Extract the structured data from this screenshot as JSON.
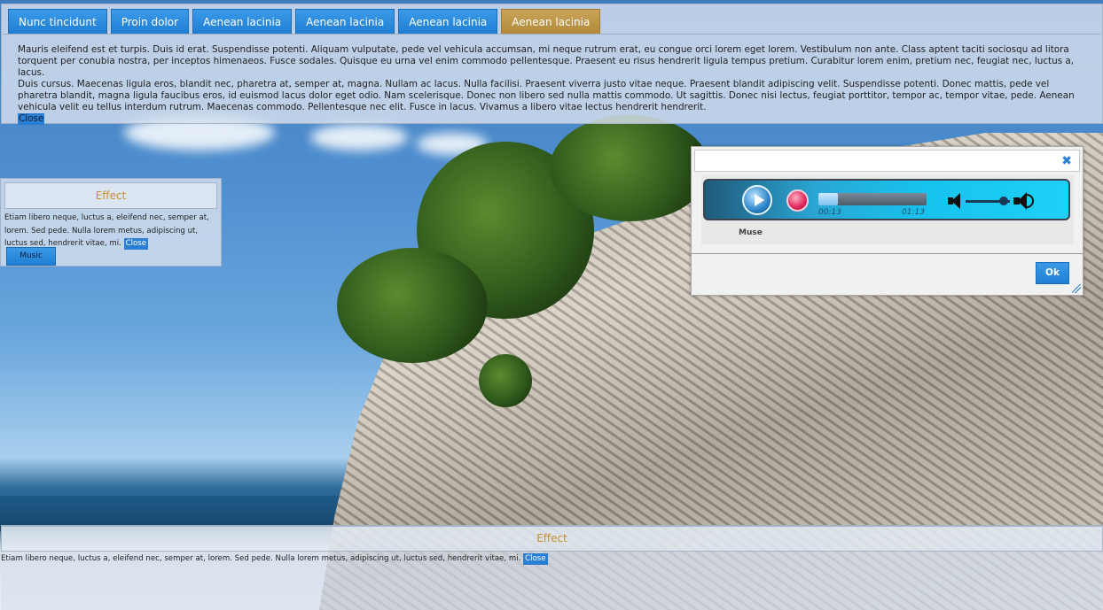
{
  "tabs": [
    {
      "label": "Nunc tincidunt",
      "active": false
    },
    {
      "label": "Proin dolor",
      "active": false
    },
    {
      "label": "Aenean lacinia",
      "active": false
    },
    {
      "label": "Aenean lacinia",
      "active": false
    },
    {
      "label": "Aenean lacinia",
      "active": false
    },
    {
      "label": "Aenean lacinia",
      "active": true
    }
  ],
  "tab_content": {
    "paragraph1": "Mauris eleifend est et turpis. Duis id erat. Suspendisse potenti. Aliquam vulputate, pede vel vehicula accumsan, mi neque rutrum erat, eu congue orci lorem eget lorem. Vestibulum non ante. Class aptent taciti sociosqu ad litora torquent per conubia nostra, per inceptos himenaeos. Fusce sodales. Quisque eu urna vel enim commodo pellentesque. Praesent eu risus hendrerit ligula tempus pretium. Curabitur lorem enim, pretium nec, feugiat nec, luctus a, lacus.",
    "paragraph2": "Duis cursus. Maecenas ligula eros, blandit nec, pharetra at, semper at, magna. Nullam ac lacus. Nulla facilisi. Praesent viverra justo vitae neque. Praesent blandit adipiscing velit. Suspendisse potenti. Donec mattis, pede vel pharetra blandit, magna ligula faucibus eros, id euismod lacus dolor eget odio. Nam scelerisque. Donec non libero sed nulla mattis commodo. Ut sagittis. Donec nisi lectus, feugiat porttitor, tempor ac, tempor vitae, pede. Aenean vehicula velit eu tellus interdum rutrum. Maecenas commodo. Pellentesque nec elit. Fusce in lacus. Vivamus a libero vitae lectus hendrerit hendrerit.",
    "close_label": "Close"
  },
  "effect_panel": {
    "header": "Effect",
    "text": "Etiam libero neque, luctus a, eleifend nec, semper at, lorem. Sed pede. Nulla lorem metus, adipiscing ut, luctus sed, hendrerit vitae, mi.",
    "close_label": "Close",
    "music_button": "Music"
  },
  "dialog": {
    "close_icon": "close-x-icon",
    "player": {
      "current_time": "00:13",
      "total_time": "01:13",
      "progress_fraction": 0.18,
      "volume_fraction": 0.85,
      "track_name": "Muse"
    },
    "ok_label": "Ok"
  },
  "bottom_panel": {
    "header": "Effect",
    "text": "Etiam libero neque, luctus a, eleifend nec, semper at, lorem. Sed pede. Nulla lorem metus, adipiscing ut, luctus sed, hendrerit vitae, mi.",
    "close_label": "Close"
  },
  "colors": {
    "accent_blue": "#2a7fd4",
    "active_tab": "#c9a45a",
    "header_text": "#c8912c"
  }
}
